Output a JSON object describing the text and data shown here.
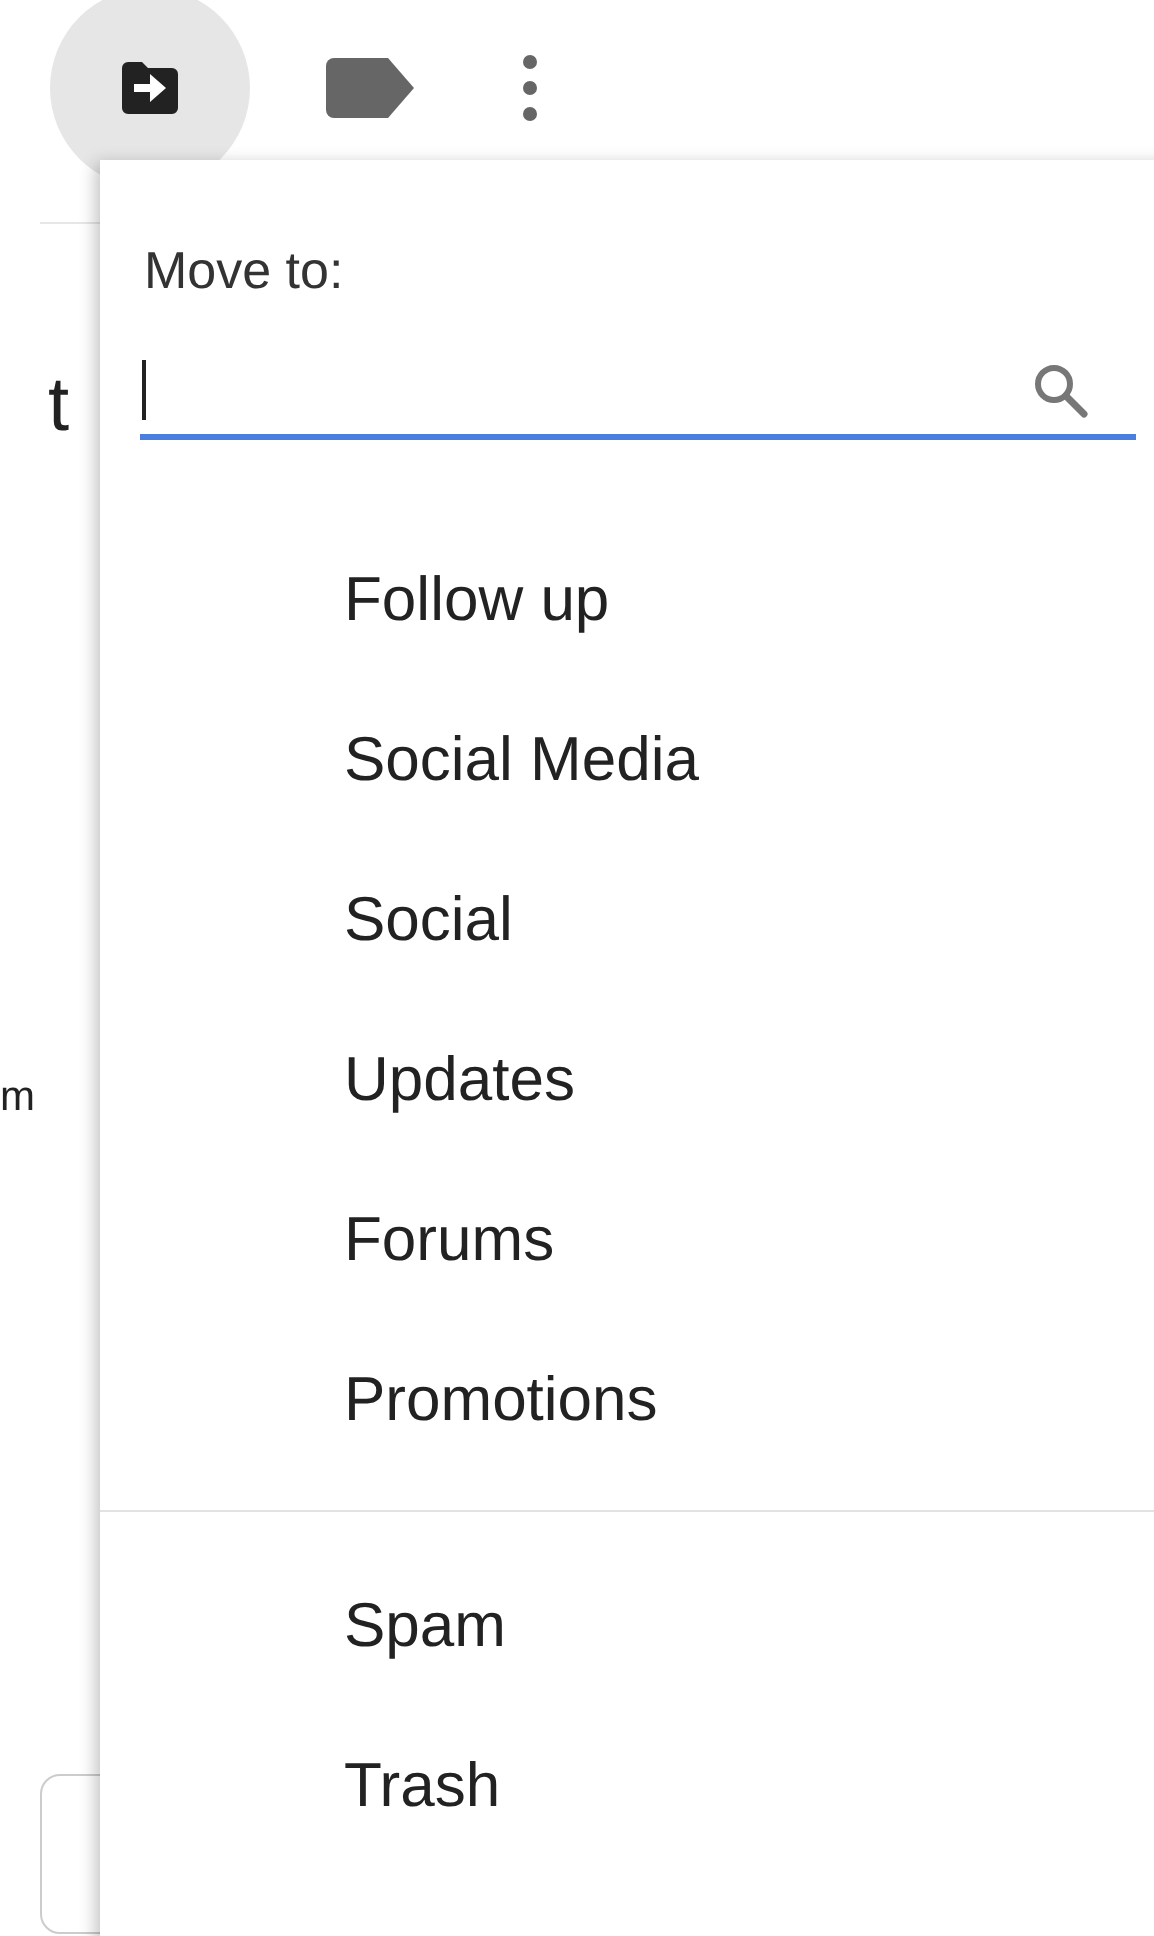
{
  "toolbar": {
    "buttons": [
      {
        "kind": "move",
        "selected": true
      },
      {
        "kind": "label",
        "selected": false
      },
      {
        "kind": "more",
        "selected": false
      }
    ]
  },
  "background": {
    "heading": "t",
    "text": "m"
  },
  "menu": {
    "title": "Move to:",
    "search": {
      "focused": true
    },
    "items": [
      "Follow up",
      "Social Media",
      "Social",
      "Updates",
      "Forums",
      "Promotions"
    ],
    "system_items": [
      "Spam",
      "Trash"
    ]
  }
}
